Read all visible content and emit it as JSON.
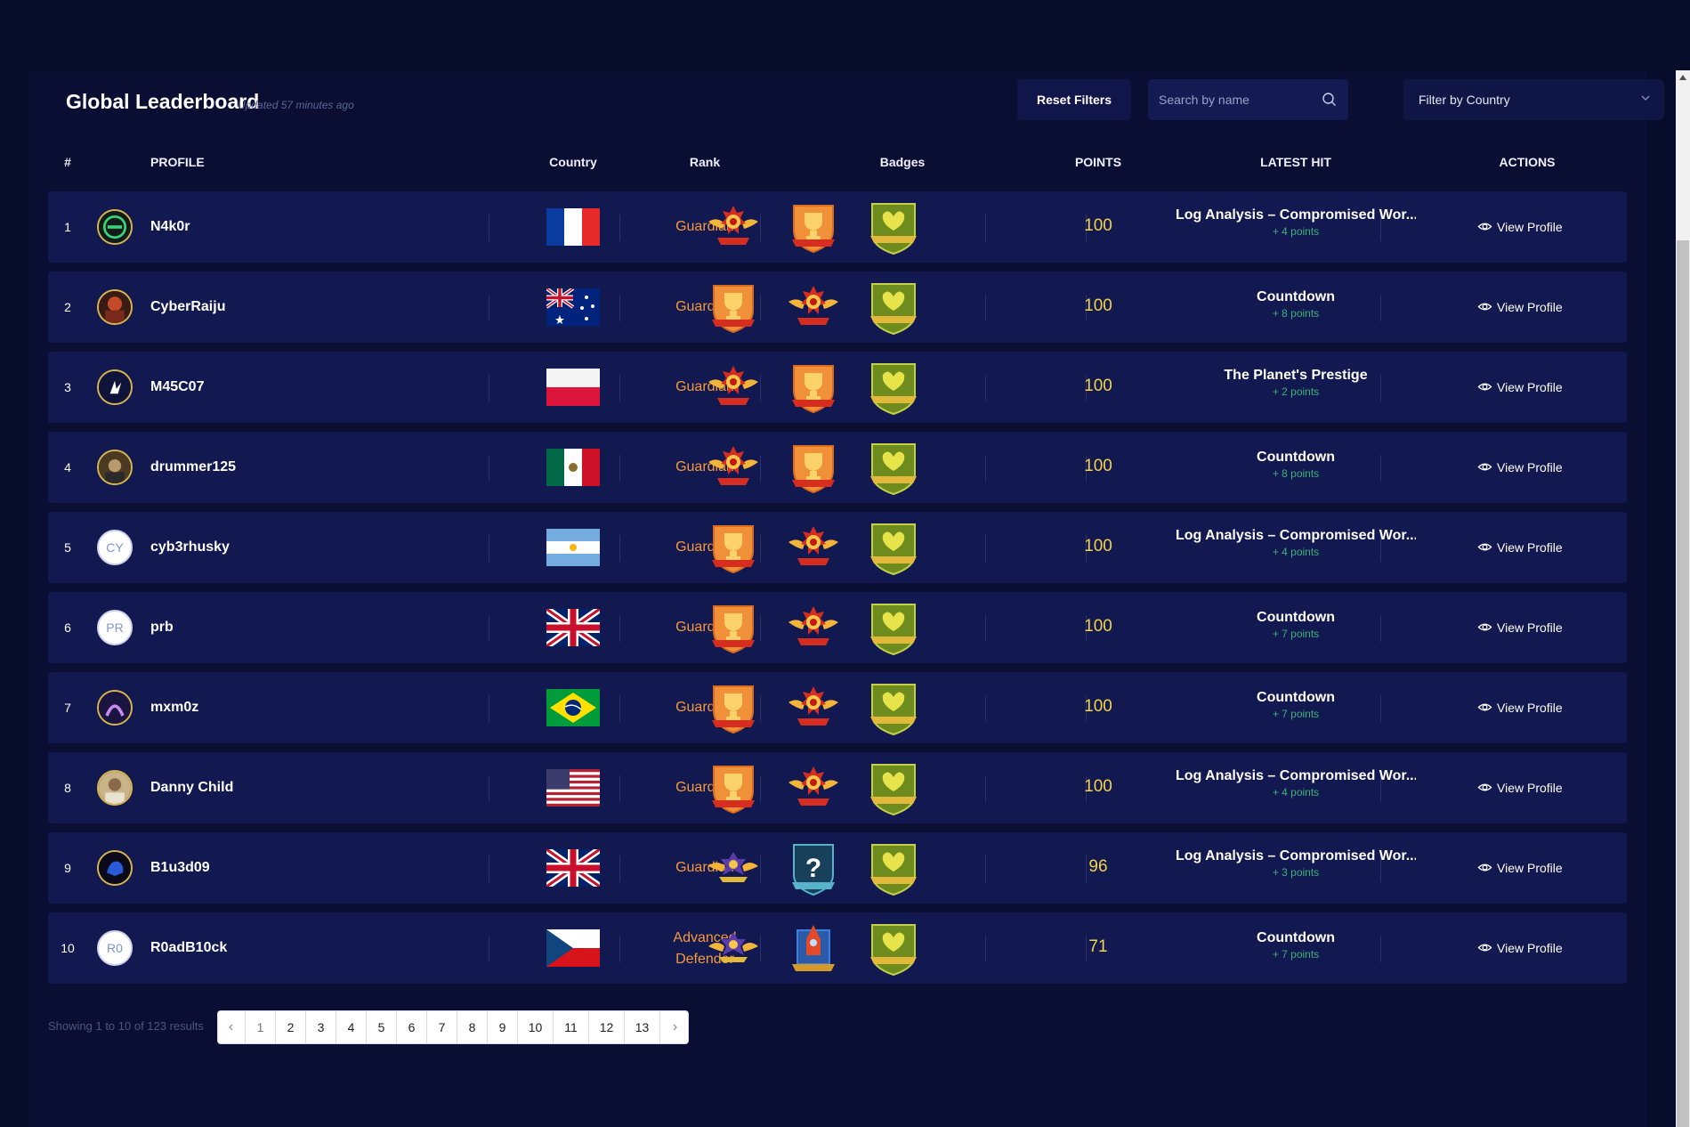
{
  "header": {
    "title": "Global Leaderboard",
    "updated": "Updated 57 minutes ago",
    "reset_label": "Reset Filters",
    "search_placeholder": "Search by name",
    "country_filter": "Filter by Country"
  },
  "columns": {
    "num": "#",
    "profile": "PROFILE",
    "country": "Country",
    "rank": "Rank",
    "badges": "Badges",
    "points": "POINTS",
    "latest_hit": "LATEST HIT",
    "actions": "ACTIONS"
  },
  "rows": [
    {
      "num": "1",
      "name": "N4k0r",
      "avatar": "logo",
      "flag": "fr",
      "rank": "Guardian",
      "badges": [
        "wings",
        "trophy",
        "shield"
      ],
      "points": "100",
      "hit": "Log Analysis – Compromised Wor...",
      "hit_points": "+ 4 points",
      "action": "View Profile"
    },
    {
      "num": "2",
      "name": "CyberRaiju",
      "avatar": "photo",
      "flag": "au",
      "rank": "Guardian",
      "badges": [
        "trophy",
        "wings",
        "shield"
      ],
      "points": "100",
      "hit": "Countdown",
      "hit_points": "+ 8 points",
      "action": "View Profile"
    },
    {
      "num": "3",
      "name": "M45C07",
      "avatar": "logo",
      "flag": "pl",
      "rank": "Guardian",
      "badges": [
        "wings",
        "trophy",
        "shield"
      ],
      "points": "100",
      "hit": "The Planet's Prestige",
      "hit_points": "+ 2 points",
      "action": "View Profile"
    },
    {
      "num": "4",
      "name": "drummer125",
      "avatar": "photo",
      "flag": "mx",
      "rank": "Guardian",
      "badges": [
        "wings",
        "trophy",
        "shield"
      ],
      "points": "100",
      "hit": "Countdown",
      "hit_points": "+ 8 points",
      "action": "View Profile"
    },
    {
      "num": "5",
      "name": "cyb3rhusky",
      "avatar": "CY",
      "flag": "ar",
      "rank": "Guardian",
      "badges": [
        "trophy",
        "wings",
        "shield"
      ],
      "points": "100",
      "hit": "Log Analysis – Compromised Wor...",
      "hit_points": "+ 4 points",
      "action": "View Profile"
    },
    {
      "num": "6",
      "name": "prb",
      "avatar": "PR",
      "flag": "gb",
      "rank": "Guardian",
      "badges": [
        "trophy",
        "wings",
        "shield"
      ],
      "points": "100",
      "hit": "Countdown",
      "hit_points": "+ 7 points",
      "action": "View Profile"
    },
    {
      "num": "7",
      "name": "mxm0z",
      "avatar": "photo",
      "flag": "br",
      "rank": "Guardian",
      "badges": [
        "trophy",
        "wings",
        "shield"
      ],
      "points": "100",
      "hit": "Countdown",
      "hit_points": "+ 7 points",
      "action": "View Profile"
    },
    {
      "num": "8",
      "name": "Danny Child",
      "avatar": "photo",
      "flag": "us",
      "rank": "Guardian",
      "badges": [
        "trophy",
        "wings",
        "shield"
      ],
      "points": "100",
      "hit": "Log Analysis – Compromised Wor...",
      "hit_points": "+ 4 points",
      "action": "View Profile"
    },
    {
      "num": "9",
      "name": "B1u3d09",
      "avatar": "photo",
      "flag": "gb",
      "rank": "Guardian",
      "badges": [
        "purple-wings",
        "mystery",
        "shield"
      ],
      "points": "96",
      "hit": "Log Analysis – Compromised Wor...",
      "hit_points": "+ 3 points",
      "action": "View Profile"
    },
    {
      "num": "10",
      "name": "R0adB10ck",
      "avatar": "R0",
      "flag": "cz",
      "rank": "Advanced Defender",
      "badges": [
        "purple-wings",
        "rocket",
        "shield"
      ],
      "points": "71",
      "hit": "Countdown",
      "hit_points": "+ 7 points",
      "action": "View Profile"
    }
  ],
  "pagination": {
    "summary": "Showing 1 to 10 of 123 results",
    "pages": [
      "1",
      "2",
      "3",
      "4",
      "5",
      "6",
      "7",
      "8",
      "9",
      "10",
      "11",
      "12",
      "13"
    ],
    "current": "1",
    "prev_icon": "chevron-left-icon",
    "next_icon": "chevron-right-icon"
  },
  "colors": {
    "background": "#080c2b",
    "row": "#121850",
    "rank": "#f59a3c",
    "points": "#f4d349",
    "hit_points": "#3fb27a"
  }
}
